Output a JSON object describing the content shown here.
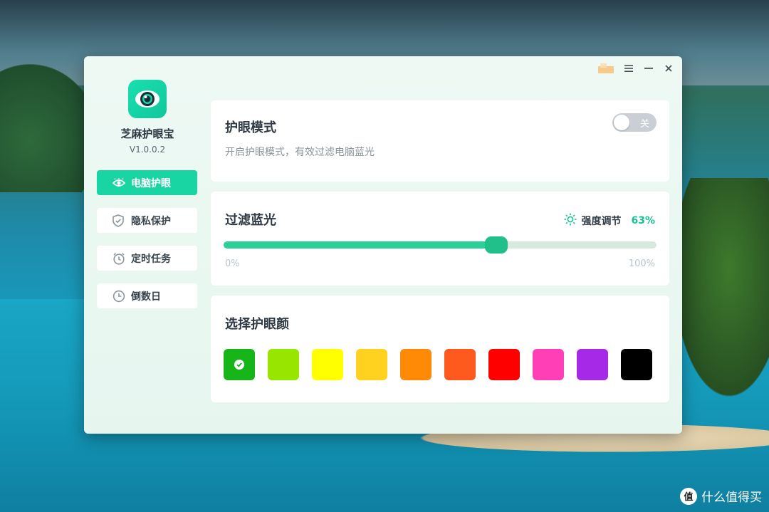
{
  "app": {
    "name": "芝麻护眼宝",
    "version": "V1.0.0.2"
  },
  "sidebar": {
    "items": [
      {
        "label": "电脑护眼",
        "icon": "eye-icon",
        "active": true
      },
      {
        "label": "隐私保护",
        "icon": "shield-icon",
        "active": false
      },
      {
        "label": "定时任务",
        "icon": "alarm-clock-icon",
        "active": false
      },
      {
        "label": "倒数日",
        "icon": "clock-icon",
        "active": false
      }
    ]
  },
  "eye_mode": {
    "title": "护眼模式",
    "description": "开启护眼模式，有效过滤电脑蓝光",
    "toggle_label": "关",
    "enabled": false
  },
  "blue_filter": {
    "title": "过滤蓝光",
    "intensity_label": "强度调节",
    "value_text": "63%",
    "value": 63,
    "min_label": "0%",
    "max_label": "100%"
  },
  "colors": {
    "title": "选择护眼颜",
    "swatches": [
      "#17b41a",
      "#98e600",
      "#ffff00",
      "#ffd21f",
      "#ff8a05",
      "#ff5a1e",
      "#ff0000",
      "#ff3fb6",
      "#a729e8",
      "#000000"
    ],
    "selected_index": 0
  },
  "theme": {
    "accent": "#19d4a3"
  },
  "watermark": {
    "badge": "值",
    "text": "什么值得买"
  }
}
